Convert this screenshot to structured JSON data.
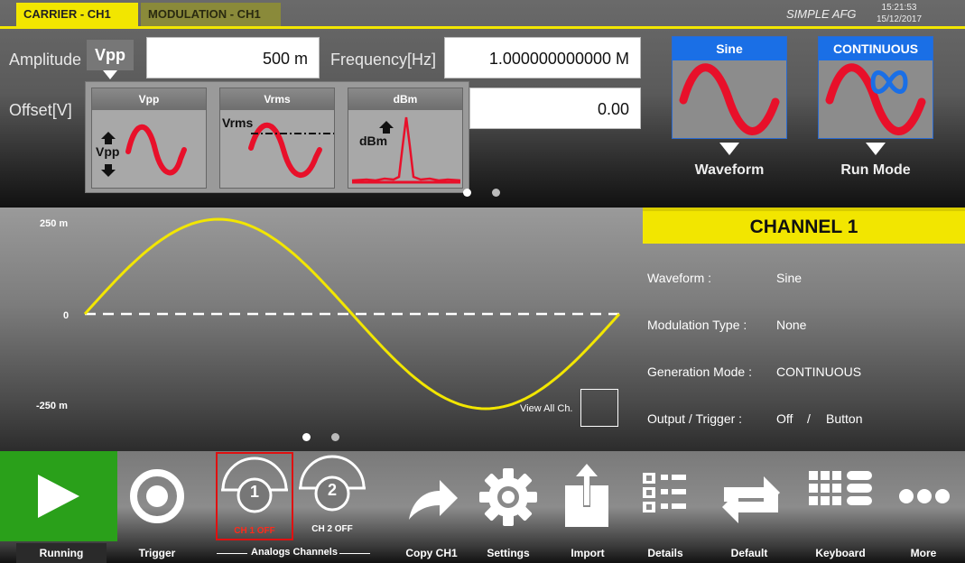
{
  "tabs": {
    "carrier": "CARRIER - CH1",
    "modulation": "MODULATION - CH1"
  },
  "brand": "SIMPLE AFG",
  "clock": {
    "time": "15:21:53",
    "date": "15/12/2017"
  },
  "carrier": {
    "amplitude_label": "Amplitude",
    "amplitude_unit": "Vpp",
    "amplitude_value": "500 m",
    "frequency_label": "Frequency[Hz]",
    "frequency_value": "1.000000000000 M",
    "offset_label": "Offset[V]",
    "offset_value": "0.00"
  },
  "unit_options": [
    {
      "head": "Vpp",
      "text": "Vpp"
    },
    {
      "head": "Vrms",
      "text": "Vrms"
    },
    {
      "head": "dBm",
      "text": "dBm"
    }
  ],
  "waveform_button": {
    "head": "Sine",
    "caption": "Waveform"
  },
  "runmode_button": {
    "head": "CONTINUOUS",
    "caption": "Run Mode"
  },
  "plot": {
    "y_max": "250 m",
    "y_zero": "0",
    "y_min": "-250 m",
    "view_all": "View All Ch."
  },
  "channel": {
    "title": "CHANNEL 1",
    "rows": [
      {
        "label": "Waveform :",
        "value": "Sine"
      },
      {
        "label": "Modulation Type :",
        "value": "None"
      },
      {
        "label": "Generation Mode :",
        "value": "CONTINUOUS"
      },
      {
        "label": "Output / Trigger :",
        "value": "Off",
        "sep": "/",
        "value2": "Button"
      }
    ]
  },
  "toolbar": {
    "running": "Running",
    "trigger": "Trigger",
    "analog_channels": "Analogs Channels",
    "ch1_num": "1",
    "ch1_status": "CH 1 OFF",
    "ch2_num": "2",
    "ch2_status": "CH 2 OFF",
    "copy": "Copy CH1",
    "settings": "Settings",
    "import": "Import",
    "details": "Details",
    "default": "Default",
    "keyboard": "Keyboard",
    "more": "More"
  },
  "colors": {
    "accent_yellow": "#f2e600",
    "run_green": "#2aa01a",
    "wave_red": "#e8102a",
    "btn_blue": "#1a6fe6",
    "ch1_off_red": "#ff2a1a"
  }
}
